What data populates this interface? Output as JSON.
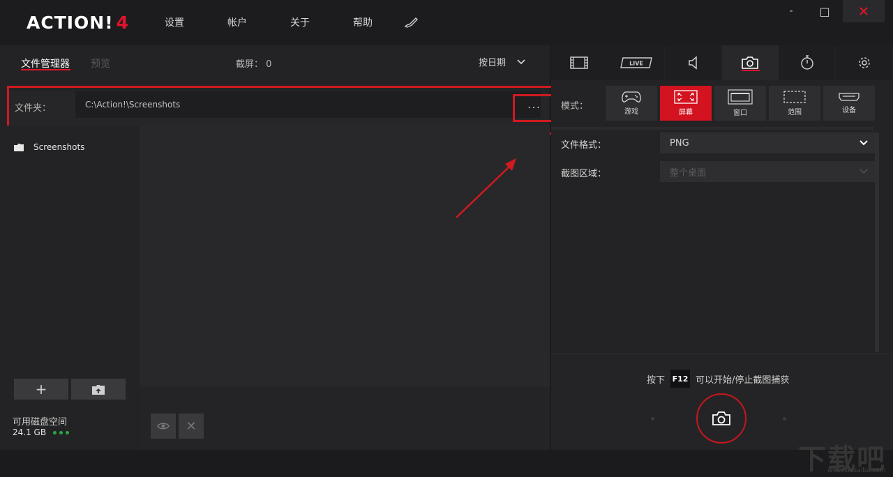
{
  "app": {
    "logo_text": "ACTION!",
    "logo_number": "4",
    "menu": [
      "设置",
      "帐户",
      "关于",
      "帮助"
    ],
    "window": {
      "minimize": "-",
      "maximize": "□",
      "close": "✕"
    }
  },
  "left_panel": {
    "tab_files": "文件管理器",
    "tab_preview": "预览",
    "screenshot_count_label": "截屏：",
    "screenshot_count": "0",
    "sort_label": "按日期",
    "folder_label": "文件夹：",
    "folder_path": "C:\\Action!\\Screenshots",
    "browse_label": "···",
    "tree_items": [
      "Screenshots"
    ],
    "disk_label": "可用磁盘空间",
    "disk_value": "24.1 GB",
    "add_button": "+",
    "delete_button": "✕"
  },
  "right_panel": {
    "tabs": [
      "video-tab",
      "live-tab",
      "audio-tab",
      "screenshot-tab",
      "timer-tab",
      "settings-tab"
    ],
    "live_text": "LIVE",
    "mode_label": "模式：",
    "modes": [
      {
        "label": "游戏",
        "icon": "gamepad-icon"
      },
      {
        "label": "屏幕",
        "icon": "fullscreen-icon"
      },
      {
        "label": "窗口",
        "icon": "window-icon"
      },
      {
        "label": "范围",
        "icon": "region-icon"
      },
      {
        "label": "设备",
        "icon": "device-icon"
      }
    ],
    "active_mode": "屏幕",
    "file_format_label": "文件格式：",
    "file_format_value": "PNG",
    "capture_area_label": "截图区域：",
    "capture_area_value": "整个桌面",
    "hint_prefix": "按下",
    "hint_key": "F12",
    "hint_suffix": "可以开始/停止截图捕获"
  },
  "watermark": {
    "text": "下载吧",
    "sub": "www.xiazaiba.com"
  },
  "colors": {
    "accent": "#e0142a",
    "annotation": "#d01a1f",
    "background": "#1b1b1d"
  }
}
